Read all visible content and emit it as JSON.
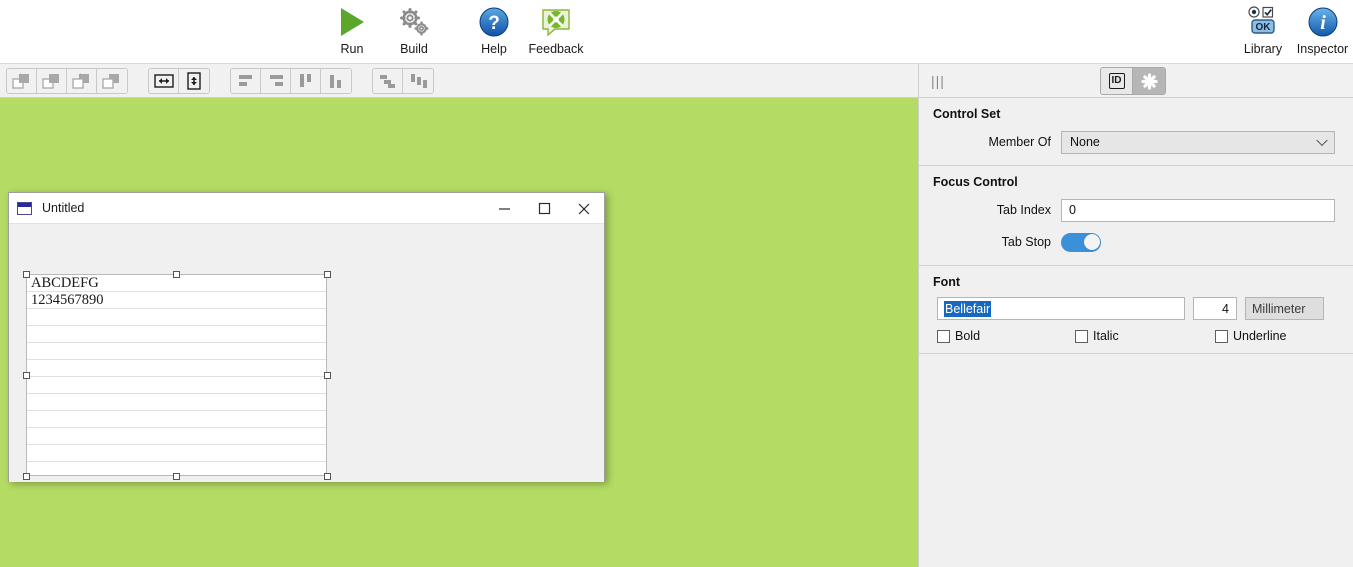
{
  "ribbon": {
    "buttons": [
      {
        "name": "run",
        "label": "Run",
        "icon": "play-triangle-icon"
      },
      {
        "name": "build",
        "label": "Build",
        "icon": "gears-icon"
      },
      {
        "name": "help",
        "label": "Help",
        "icon": "question-circle-icon"
      },
      {
        "name": "feedback",
        "label": "Feedback",
        "icon": "feedback-bubble-icon"
      },
      {
        "name": "library",
        "label": "Library",
        "icon": "library-controls-icon"
      },
      {
        "name": "inspector",
        "label": "Inspector",
        "icon": "info-circle-icon"
      }
    ],
    "library_ok_label": "OK"
  },
  "toolbar": {
    "groups": [
      {
        "name": "ordering",
        "buttons": [
          {
            "name": "bring-to-front",
            "icon": "bring-to-front-icon"
          },
          {
            "name": "bring-forward",
            "icon": "bring-forward-icon"
          },
          {
            "name": "send-to-back",
            "icon": "send-to-back-icon"
          },
          {
            "name": "send-backward",
            "icon": "send-backward-icon"
          }
        ]
      },
      {
        "name": "sizing",
        "buttons": [
          {
            "name": "resize-width",
            "icon": "resize-horizontal-icon"
          },
          {
            "name": "resize-height",
            "icon": "resize-vertical-icon"
          }
        ]
      },
      {
        "name": "alignment",
        "buttons": [
          {
            "name": "align-left",
            "icon": "align-left-icon"
          },
          {
            "name": "align-right",
            "icon": "align-right-icon"
          },
          {
            "name": "align-top",
            "icon": "align-top-icon"
          },
          {
            "name": "align-bottom",
            "icon": "align-bottom-icon"
          }
        ]
      },
      {
        "name": "distribution",
        "buttons": [
          {
            "name": "distribute-horizontally",
            "icon": "distribute-horizontal-icon"
          },
          {
            "name": "distribute-vertically",
            "icon": "distribute-vertical-icon"
          }
        ]
      }
    ]
  },
  "inspector": {
    "grip": "|||",
    "tabs": [
      {
        "name": "id-tab",
        "label": "ID",
        "active": false
      },
      {
        "name": "properties-tab",
        "label": "*",
        "active": true
      }
    ],
    "sections": [
      {
        "name": "control-set",
        "title": "Control Set",
        "fields": [
          {
            "name": "member-of",
            "label": "Member Of",
            "type": "combo",
            "value": "None"
          }
        ]
      },
      {
        "name": "focus-control",
        "title": "Focus Control",
        "fields": [
          {
            "name": "tab-index",
            "label": "Tab Index",
            "type": "text",
            "value": "0"
          },
          {
            "name": "tab-stop",
            "label": "Tab Stop",
            "type": "switch",
            "value": "on"
          }
        ]
      },
      {
        "name": "font",
        "title": "Font",
        "family": "Bellefair",
        "size": "4",
        "unit": "Millimeter",
        "styles": [
          {
            "name": "bold",
            "label": "Bold",
            "checked": false
          },
          {
            "name": "italic",
            "label": "Italic",
            "checked": false
          },
          {
            "name": "underline",
            "label": "Underline",
            "checked": false
          }
        ]
      }
    ]
  },
  "design_window": {
    "title": "Untitled",
    "window_controls": [
      {
        "name": "minimize-button",
        "glyph": "—"
      },
      {
        "name": "maximize-button",
        "glyph": "□"
      },
      {
        "name": "close-button",
        "glyph": "✕"
      }
    ],
    "selected_control": {
      "name": "multiline-text-control",
      "lines": [
        "ABCDEFG",
        "1234567890",
        "",
        "",
        "",
        "",
        "",
        "",
        "",
        "",
        "",
        ""
      ]
    }
  },
  "colors": {
    "canvas": "#b4dc64",
    "accent_blue": "#3b90d9",
    "selection_blue": "#1669c1",
    "run_green": "#5aa72b"
  }
}
